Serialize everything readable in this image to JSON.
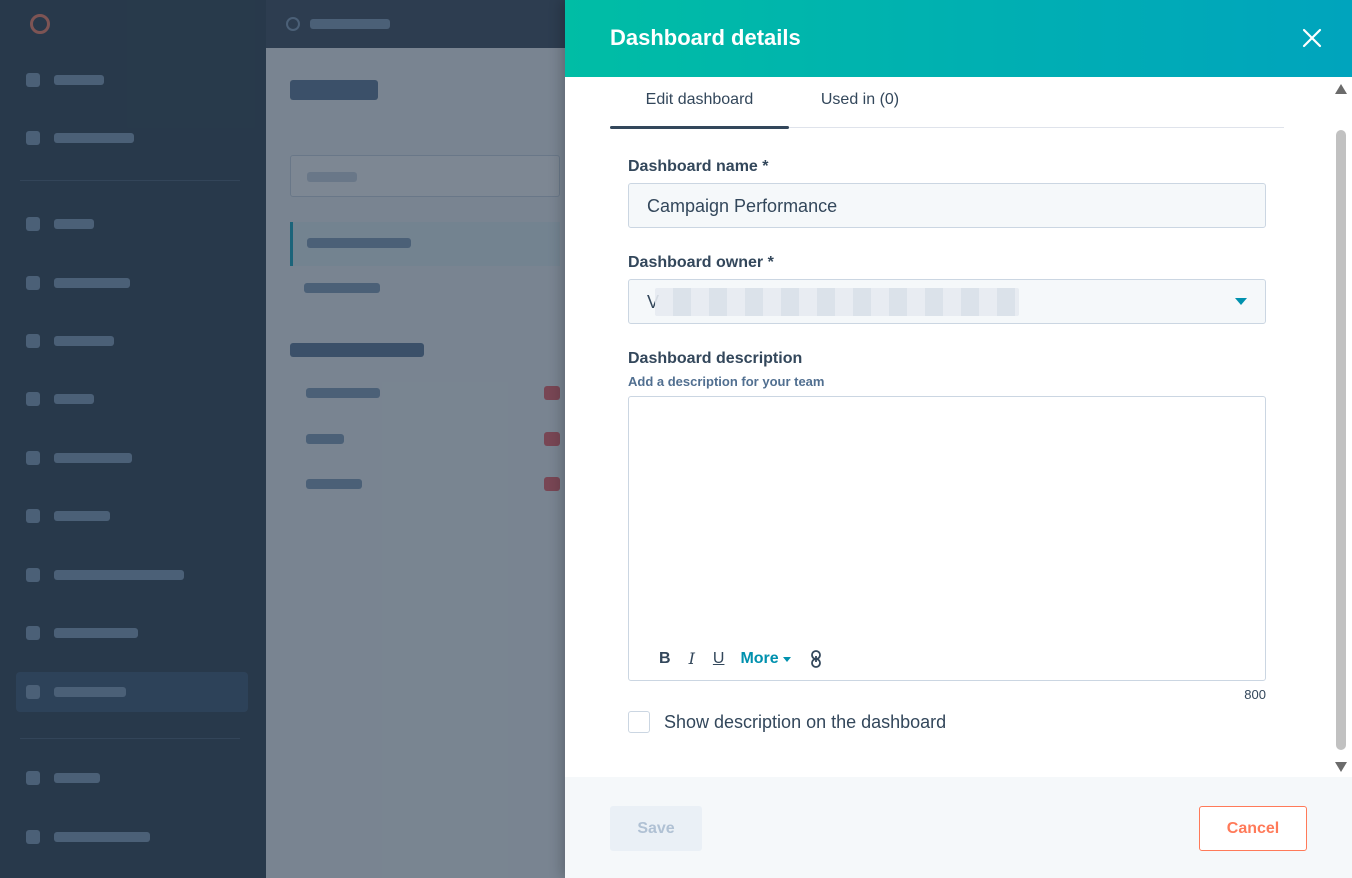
{
  "colors": {
    "header_gradient_start": "#00bda5",
    "header_gradient_end": "#00a4bd",
    "text_primary": "#33475b",
    "accent_link": "#0091ae",
    "cancel_orange": "#ff7a59",
    "overlay": "#2d3e50"
  },
  "panel": {
    "title": "Dashboard details",
    "close_icon": "close-icon"
  },
  "tabs": [
    {
      "label": "Edit dashboard",
      "active": true
    },
    {
      "label": "Used in (0)",
      "active": false
    }
  ],
  "form": {
    "name_label": "Dashboard name *",
    "name_value": "Campaign Performance",
    "owner_label": "Dashboard owner *",
    "owner_value": "V",
    "description_label": "Dashboard description",
    "description_help": "Add a description for your team",
    "description_value": "",
    "toolbar": {
      "bold": "B",
      "italic": "I",
      "underline": "U",
      "more": "More"
    },
    "char_limit": "800",
    "show_description_label": "Show description on the dashboard",
    "show_description_checked": false
  },
  "footer": {
    "save_label": "Save",
    "cancel_label": "Cancel"
  }
}
